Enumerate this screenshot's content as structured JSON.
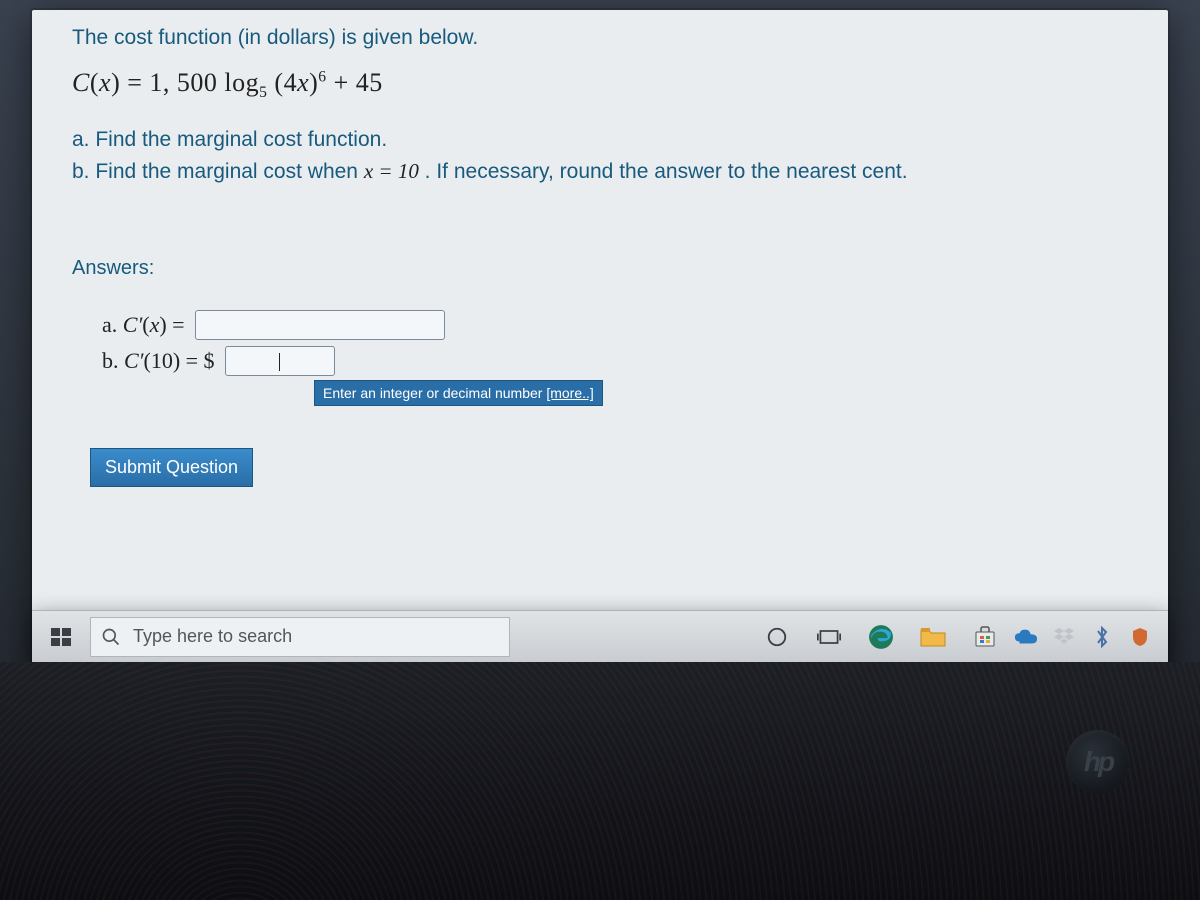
{
  "question": {
    "intro": "The cost function (in dollars) is given below.",
    "formula_html": "C(x) = 1,500 log<sub>5</sub> (4x)<sup>6</sup> + 45",
    "part_a": "a. Find the marginal cost function.",
    "part_b_prefix": "b. Find the marginal cost when ",
    "part_b_math": "x = 10",
    "part_b_suffix": " . If necessary, round the answer to the nearest cent."
  },
  "answers": {
    "label": "Answers:",
    "row_a_label": "a. ",
    "row_a_math": "C′(x) = ",
    "row_a_value": "",
    "row_b_label": "b. ",
    "row_b_math": "C′(10) = $",
    "row_b_value": "",
    "row_b_cursor": "I",
    "hint_text": "Enter an integer or decimal number ",
    "hint_more": "[more..]"
  },
  "buttons": {
    "submit": "Submit Question"
  },
  "taskbar": {
    "search_placeholder": "Type here to search",
    "hp": "hp"
  }
}
